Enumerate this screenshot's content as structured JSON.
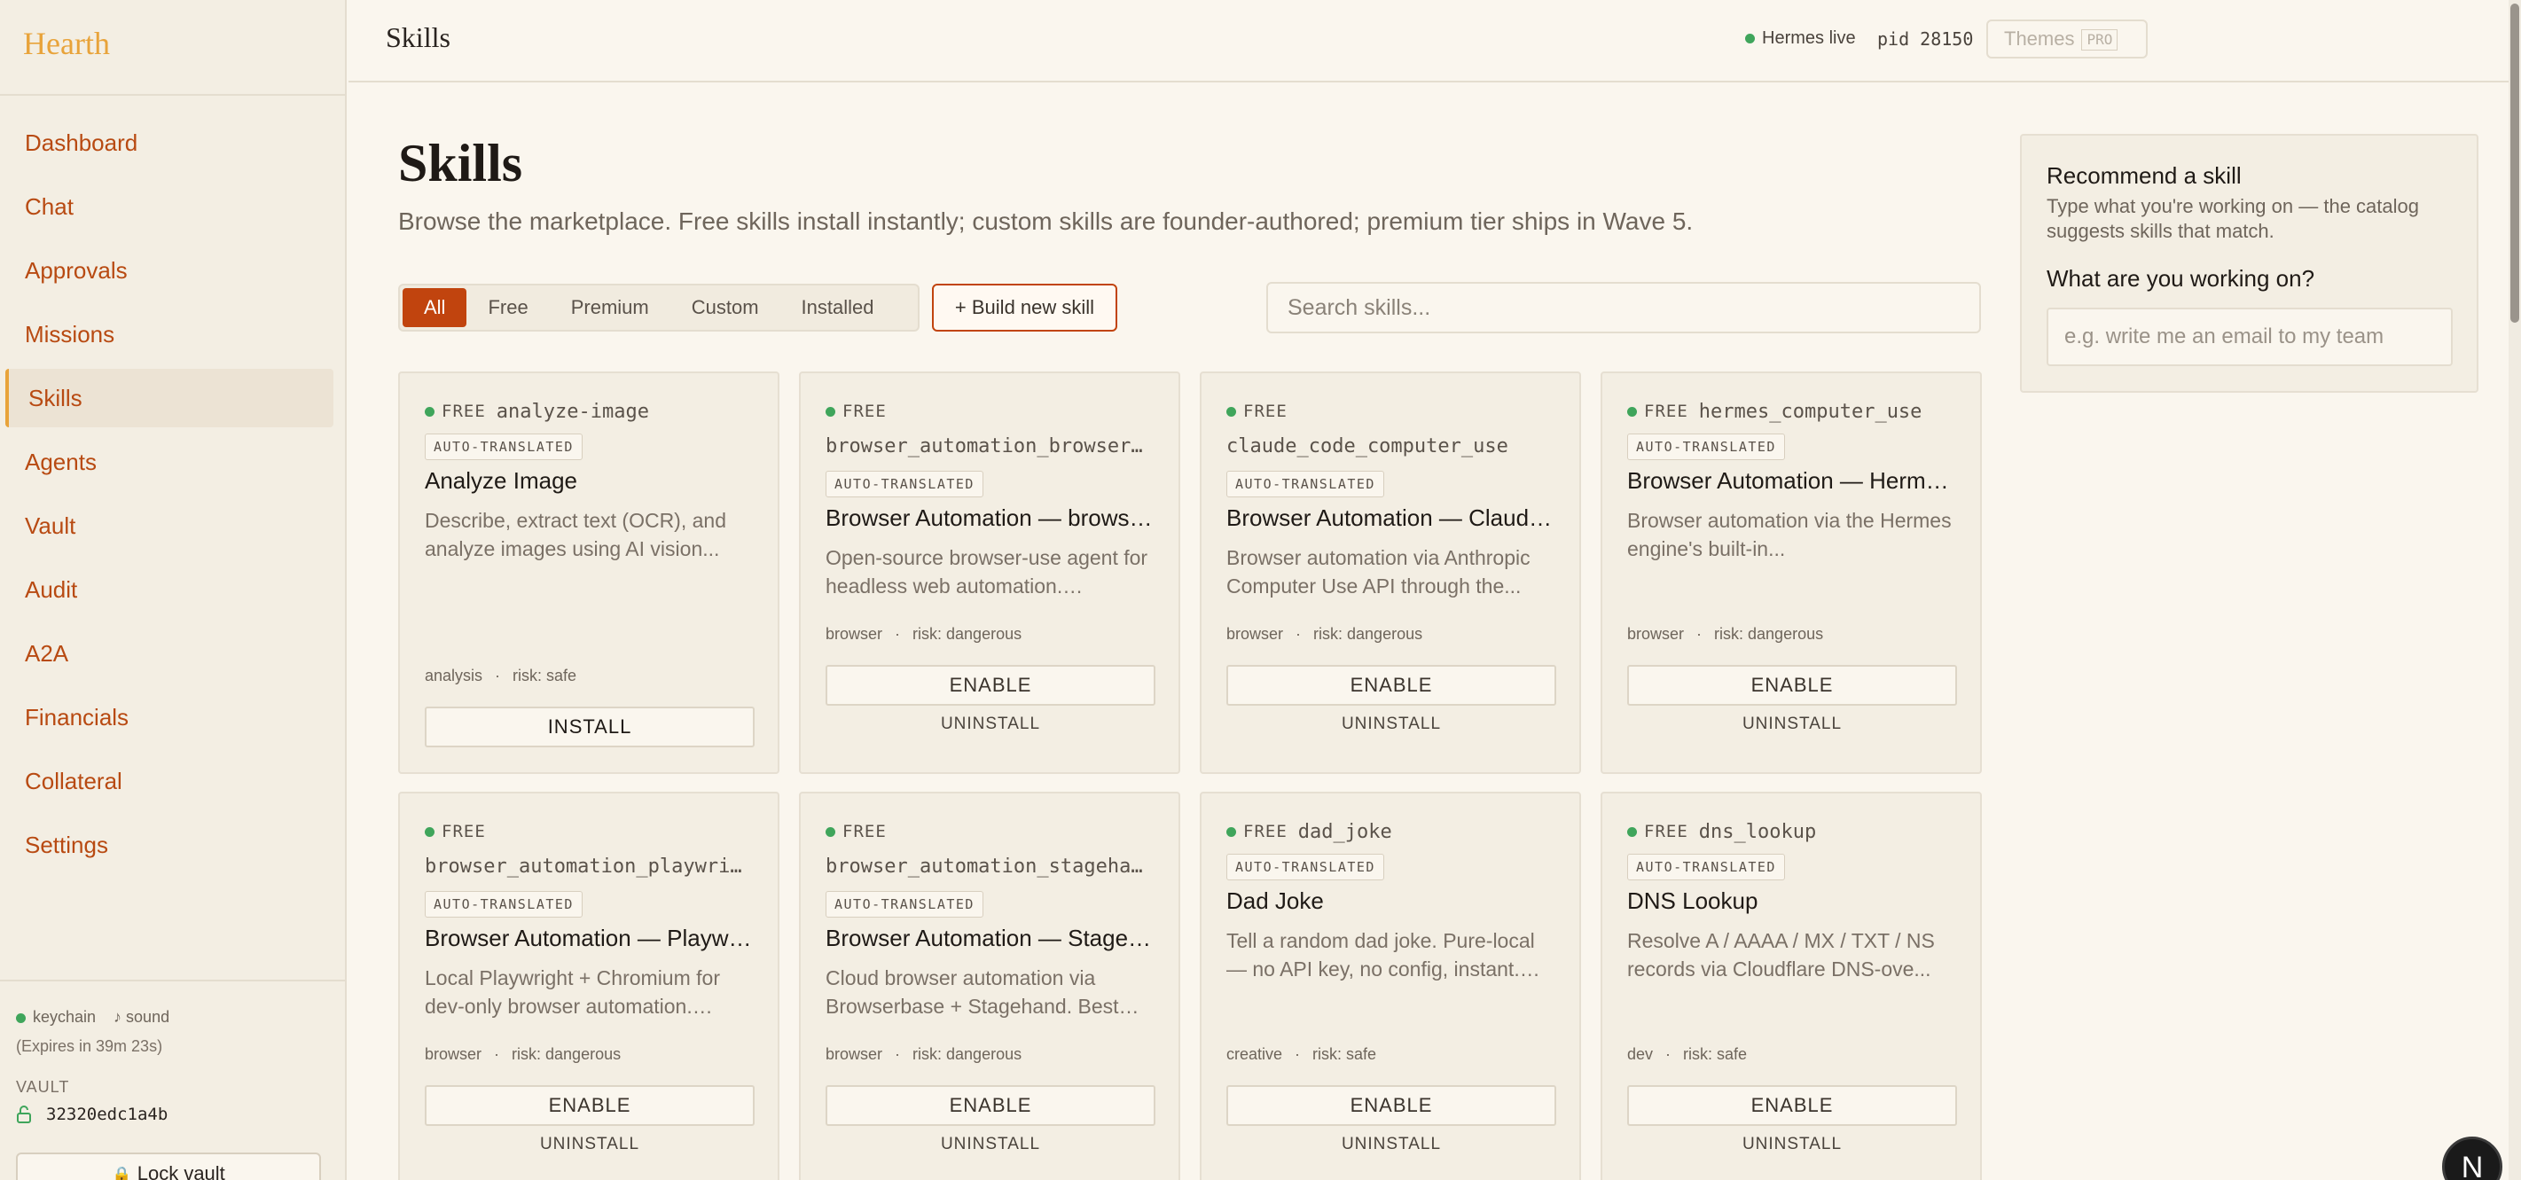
{
  "app": {
    "name": "Hearth"
  },
  "sidebar": {
    "items": [
      {
        "label": "Dashboard"
      },
      {
        "label": "Chat"
      },
      {
        "label": "Approvals"
      },
      {
        "label": "Missions"
      },
      {
        "label": "Skills",
        "active": true
      },
      {
        "label": "Agents"
      },
      {
        "label": "Vault"
      },
      {
        "label": "Audit"
      },
      {
        "label": "A2A"
      },
      {
        "label": "Financials"
      },
      {
        "label": "Collateral"
      },
      {
        "label": "Settings"
      }
    ],
    "status": {
      "keychain": "keychain",
      "sound": "♪ sound",
      "expires": "(Expires in 39m 23s)"
    },
    "vault": {
      "label": "VAULT",
      "id": "32320edc1a4b",
      "lock_label": "Lock vault"
    }
  },
  "header": {
    "title": "Skills",
    "hermes_status": "Hermes live",
    "pid": "pid 28150",
    "themes_label": "Themes",
    "pro_badge": "PRO"
  },
  "main": {
    "title": "Skills",
    "subtitle": "Browse the marketplace. Free skills install instantly; custom skills are founder-authored; premium tier ships in Wave 5.",
    "filters": [
      "All",
      "Free",
      "Premium",
      "Custom",
      "Installed"
    ],
    "active_filter": "All",
    "build_button": "+ Build new skill",
    "search_placeholder": "Search skills...",
    "cards": [
      {
        "tier": "FREE",
        "slug": "analyze-image",
        "slug_inline": true,
        "badge": "AUTO-TRANSLATED",
        "title": "Analyze Image",
        "description": "Describe, extract text (OCR), and analyze images using AI vision...",
        "category": "analysis",
        "risk": "risk: safe",
        "action": "INSTALL",
        "secondary": ""
      },
      {
        "tier": "FREE",
        "slug": "browser_automation_browser_…",
        "slug_inline": false,
        "badge": "AUTO-TRANSLATED",
        "title": "Browser Automation — brows…",
        "description": "Open-source browser-use agent for headless web automation.…",
        "category": "browser",
        "risk": "risk: dangerous",
        "action": "ENABLE",
        "secondary": "UNINSTALL"
      },
      {
        "tier": "FREE",
        "slug": "claude_code_computer_use",
        "slug_inline": false,
        "badge": "AUTO-TRANSLATED",
        "title": "Browser Automation — Claud…",
        "description": "Browser automation via Anthropic Computer Use API through the...",
        "category": "browser",
        "risk": "risk: dangerous",
        "action": "ENABLE",
        "secondary": "UNINSTALL"
      },
      {
        "tier": "FREE",
        "slug": "hermes_computer_use",
        "slug_inline": true,
        "badge": "AUTO-TRANSLATED",
        "title": "Browser Automation — Herm…",
        "description": "Browser automation via the Hermes engine's built-in...",
        "category": "browser",
        "risk": "risk: dangerous",
        "action": "ENABLE",
        "secondary": "UNINSTALL"
      },
      {
        "tier": "FREE",
        "slug": "browser_automation_playwrig…",
        "slug_inline": false,
        "badge": "AUTO-TRANSLATED",
        "title": "Browser Automation — Playw…",
        "description": "Local Playwright + Chromium for dev-only browser automation.…",
        "category": "browser",
        "risk": "risk: dangerous",
        "action": "ENABLE",
        "secondary": "UNINSTALL"
      },
      {
        "tier": "FREE",
        "slug": "browser_automation_stagehand",
        "slug_inline": false,
        "badge": "AUTO-TRANSLATED",
        "title": "Browser Automation — Stage…",
        "description": "Cloud browser automation via Browserbase + Stagehand. Best…",
        "category": "browser",
        "risk": "risk: dangerous",
        "action": "ENABLE",
        "secondary": "UNINSTALL"
      },
      {
        "tier": "FREE",
        "slug": "dad_joke",
        "slug_inline": true,
        "badge": "AUTO-TRANSLATED",
        "title": "Dad Joke",
        "description": "Tell a random dad joke. Pure-local — no API key, no config, instant.…",
        "category": "creative",
        "risk": "risk: safe",
        "action": "ENABLE",
        "secondary": "UNINSTALL"
      },
      {
        "tier": "FREE",
        "slug": "dns_lookup",
        "slug_inline": true,
        "badge": "AUTO-TRANSLATED",
        "title": "DNS Lookup",
        "description": "Resolve A / AAAA / MX / TXT / NS records via Cloudflare DNS-ove...",
        "category": "dev",
        "risk": "risk: safe",
        "action": "ENABLE",
        "secondary": "UNINSTALL"
      }
    ]
  },
  "recommend": {
    "title": "Recommend a skill",
    "subtitle": "Type what you're working on — the catalog suggests skills that match.",
    "question": "What are you working on?",
    "placeholder": "e.g. write me an email to my team"
  },
  "colors": {
    "accent": "#c1440e",
    "brand": "#e8a33a",
    "status_live": "#3fa55b",
    "nav_text": "#b84a12"
  },
  "floating_badge": "N"
}
